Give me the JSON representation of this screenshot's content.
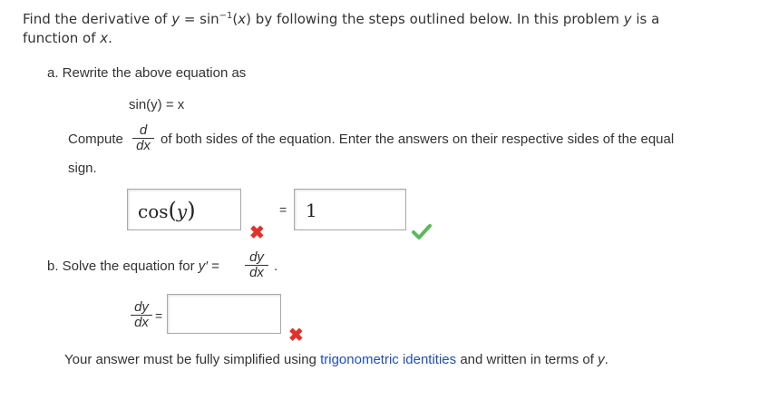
{
  "problem": {
    "intro_line1_a": "Find the derivative of ",
    "intro_y": "y",
    "intro_eq": " = sin",
    "intro_sup": "−1",
    "intro_arg_open": "(",
    "intro_arg_x": "x",
    "intro_arg_close": ")",
    "intro_line1_b": " by following the steps outlined below. In this problem ",
    "intro_y2": "y",
    "intro_line1_c": " is a",
    "intro_line2_a": "function of ",
    "intro_x": "x",
    "intro_line2_b": "."
  },
  "part_a": {
    "label": "a. Rewrite the above equation as",
    "equation": "sin(y) = x",
    "compute_label": "Compute",
    "deriv_num": "d",
    "deriv_den": "dx",
    "compute_rest": "of both sides of the equation. Enter the answers on their respective sides of the equal",
    "compute_rest_line2": "sign.",
    "left_answer": {
      "func": "cos",
      "open": "(",
      "var": "y",
      "close": ")",
      "status": "incorrect"
    },
    "equals": "=",
    "right_answer": {
      "value": "1",
      "status": "correct"
    }
  },
  "part_b": {
    "label": "b. Solve the equation for ",
    "yprime": "y′",
    "eq": " = ",
    "frac_num": "dy",
    "frac_den": "dx",
    "period": ".",
    "answer_num": "dy",
    "answer_den": "dx",
    "answer_eq": "=",
    "answer_value": "",
    "answer_status": "incorrect"
  },
  "footer": {
    "text_a": "Your answer must be fully simplified using ",
    "link": "trigonometric identities",
    "text_b": " and written in terms of ",
    "y": "y",
    "text_c": "."
  },
  "colors": {
    "incorrect": "#e0312c",
    "correct": "#5cb85c",
    "link": "#1f4fb8"
  },
  "icons": {
    "incorrect": "x-icon",
    "correct": "check-icon"
  }
}
